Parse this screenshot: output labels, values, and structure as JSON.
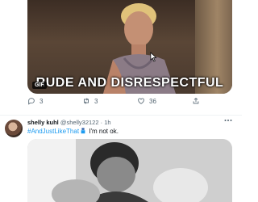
{
  "gif": {
    "caption": "RUDE AND DISRESPECTFUL",
    "badge": "GIF"
  },
  "actions": {
    "reply_count": "3",
    "retweet_count": "3",
    "like_count": "36"
  },
  "tweet": {
    "display_name": "shelly kuhl",
    "handle": "@shelly32122",
    "separator": " · ",
    "time": "1h",
    "hashtag": "#AndJustLikeThat",
    "text": " I'm not ok.",
    "emoji": "nail-polish-icon"
  },
  "colors": {
    "accent": "#1d9bf0",
    "muted": "#536471",
    "divider": "#eff3f4"
  }
}
